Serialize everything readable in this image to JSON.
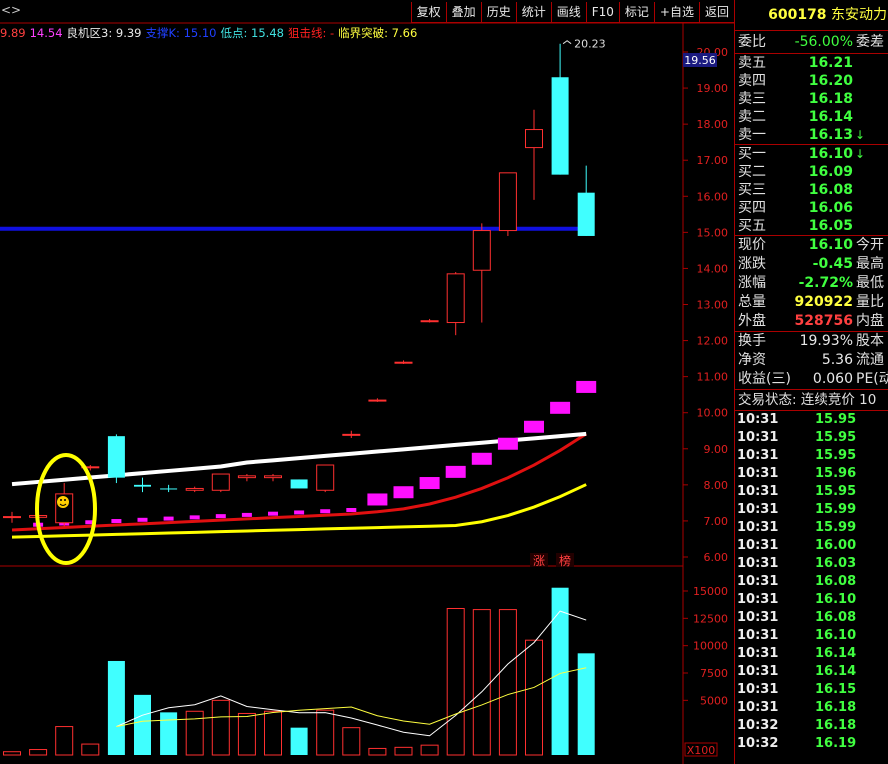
{
  "toolbar": {
    "nav_arrows": "<>",
    "buttons": [
      "复权",
      "叠加",
      "历史",
      "统计",
      "画线",
      "F10",
      "标记",
      "+自选",
      "返回"
    ]
  },
  "indicators": [
    {
      "text": "9.89",
      "color": "#ff4040"
    },
    {
      "text": "14.54",
      "color": "#ff40ff"
    },
    {
      "text": "良机区3: 9.39",
      "color": "#e8e8e8"
    },
    {
      "text": "支撑K: 15.10",
      "color": "#2040ff"
    },
    {
      "text": "低点: 15.48",
      "color": "#40e0e0"
    },
    {
      "text": "狙击线: -",
      "color": "#ff2020"
    },
    {
      "text": "临界突破: 7.66",
      "color": "#ffff40"
    }
  ],
  "price_axis": {
    "labels": [
      "20.00",
      "19.00",
      "18.00",
      "17.00",
      "16.00",
      "15.00",
      "14.00",
      "13.00",
      "12.00",
      "11.00",
      "10.00",
      "9.00",
      "8.00",
      "7.00",
      "6.00"
    ],
    "current_marker": "19.56",
    "high_annotation": "20.23"
  },
  "volume_axis": {
    "labels": [
      "15000",
      "12500",
      "10000",
      "7500",
      "5000"
    ],
    "unit": "X100"
  },
  "badges": [
    "涨",
    "榜"
  ],
  "chart_data": {
    "type": "candlestick",
    "candles": [
      {
        "o": 7.1,
        "h": 7.25,
        "l": 6.95,
        "c": 7.12
      },
      {
        "o": 7.1,
        "h": 7.2,
        "l": 7.0,
        "c": 7.15
      },
      {
        "o": 6.95,
        "h": 8.05,
        "l": 6.85,
        "c": 7.75
      },
      {
        "o": 8.5,
        "h": 8.55,
        "l": 8.4,
        "c": 8.5
      },
      {
        "o": 9.35,
        "h": 9.4,
        "l": 8.05,
        "c": 8.2
      },
      {
        "o": 8.0,
        "h": 8.2,
        "l": 7.8,
        "c": 7.95
      },
      {
        "o": 7.9,
        "h": 8.0,
        "l": 7.8,
        "c": 7.88
      },
      {
        "o": 7.85,
        "h": 7.95,
        "l": 7.8,
        "c": 7.9
      },
      {
        "o": 7.85,
        "h": 8.3,
        "l": 7.8,
        "c": 8.3
      },
      {
        "o": 8.2,
        "h": 8.3,
        "l": 8.1,
        "c": 8.25
      },
      {
        "o": 8.2,
        "h": 8.3,
        "l": 8.1,
        "c": 8.25
      },
      {
        "o": 8.15,
        "h": 8.15,
        "l": 7.9,
        "c": 7.9
      },
      {
        "o": 7.85,
        "h": 8.55,
        "l": 7.8,
        "c": 8.55
      },
      {
        "o": 9.4,
        "h": 9.5,
        "l": 9.3,
        "c": 9.4
      },
      {
        "o": 10.35,
        "h": 10.4,
        "l": 10.3,
        "c": 10.35
      },
      {
        "o": 11.4,
        "h": 11.45,
        "l": 11.35,
        "c": 11.4
      },
      {
        "o": 12.55,
        "h": 12.6,
        "l": 12.5,
        "c": 12.55
      },
      {
        "o": 12.5,
        "h": 13.9,
        "l": 12.15,
        "c": 13.85
      },
      {
        "o": 13.95,
        "h": 15.25,
        "l": 12.5,
        "c": 15.05
      },
      {
        "o": 15.05,
        "h": 16.65,
        "l": 14.9,
        "c": 16.65
      },
      {
        "o": 17.35,
        "h": 18.4,
        "l": 15.9,
        "c": 17.85
      },
      {
        "o": 19.3,
        "h": 20.23,
        "l": 16.6,
        "c": 16.6
      },
      {
        "o": 16.1,
        "h": 16.85,
        "l": 14.9,
        "c": 14.9
      }
    ],
    "volume": [
      300,
      500,
      2600,
      1000,
      8600,
      5500,
      3900,
      4000,
      5000,
      3800,
      4000,
      2500,
      4100,
      2500,
      600,
      700,
      900,
      13400,
      13300,
      13300,
      10500,
      15300,
      9300
    ],
    "support_line": 15.1
  },
  "quote": {
    "code": "600178",
    "name": "东安动力",
    "weibi_label": "委比",
    "weibi_value": "-56.00%",
    "weicha_label": "委差",
    "sells": [
      {
        "label": "卖五",
        "price": "16.21"
      },
      {
        "label": "卖四",
        "price": "16.20"
      },
      {
        "label": "卖三",
        "price": "16.18"
      },
      {
        "label": "卖二",
        "price": "16.14"
      },
      {
        "label": "卖一",
        "price": "16.13",
        "arrow": "↓"
      }
    ],
    "buys": [
      {
        "label": "买一",
        "price": "16.10",
        "arrow": "↓"
      },
      {
        "label": "买二",
        "price": "16.09"
      },
      {
        "label": "买三",
        "price": "16.08"
      },
      {
        "label": "买四",
        "price": "16.06"
      },
      {
        "label": "买五",
        "price": "16.05"
      }
    ],
    "stats": [
      {
        "label": "现价",
        "value": "16.10",
        "color": "#40ff40",
        "ext": "今开"
      },
      {
        "label": "涨跌",
        "value": "-0.45",
        "color": "#40ff40",
        "ext": "最高"
      },
      {
        "label": "涨幅",
        "value": "-2.72%",
        "color": "#40ff40",
        "ext": "最低"
      },
      {
        "label": "总量",
        "value": "920922",
        "color": "#ffff40",
        "ext": "量比"
      },
      {
        "label": "外盘",
        "value": "528756",
        "color": "#ff4040",
        "ext": "内盘"
      }
    ],
    "stats2": [
      {
        "label": "换手",
        "value": "19.93%",
        "ext": "股本"
      },
      {
        "label": "净资",
        "value": "5.36",
        "ext": "流通"
      },
      {
        "label": "收益(三)",
        "value": "0.060",
        "ext": "PE(动"
      }
    ],
    "trade_status": "交易状态: 连续竞价 10"
  },
  "ticks": [
    {
      "t": "10:31",
      "p": "15.95"
    },
    {
      "t": "10:31",
      "p": "15.95"
    },
    {
      "t": "10:31",
      "p": "15.95"
    },
    {
      "t": "10:31",
      "p": "15.96"
    },
    {
      "t": "10:31",
      "p": "15.95"
    },
    {
      "t": "10:31",
      "p": "15.99"
    },
    {
      "t": "10:31",
      "p": "15.99"
    },
    {
      "t": "10:31",
      "p": "16.00"
    },
    {
      "t": "10:31",
      "p": "16.03"
    },
    {
      "t": "10:31",
      "p": "16.08"
    },
    {
      "t": "10:31",
      "p": "16.10"
    },
    {
      "t": "10:31",
      "p": "16.08"
    },
    {
      "t": "10:31",
      "p": "16.10"
    },
    {
      "t": "10:31",
      "p": "16.14"
    },
    {
      "t": "10:31",
      "p": "16.14"
    },
    {
      "t": "10:31",
      "p": "16.15"
    },
    {
      "t": "10:31",
      "p": "16.18"
    },
    {
      "t": "10:32",
      "p": "16.18"
    },
    {
      "t": "10:32",
      "p": "16.19"
    }
  ]
}
